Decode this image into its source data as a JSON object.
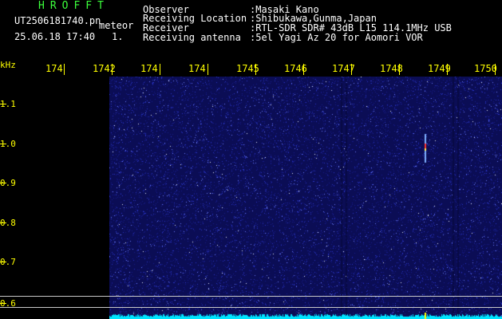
{
  "header": {
    "station_code": "HROFFT",
    "filename": "UT2506181740.pn",
    "mode": "meteor",
    "datetime": "25.06.18 17:40",
    "sequence": "1.",
    "fields": [
      {
        "label": "Observer",
        "value": ":Masaki Kano"
      },
      {
        "label": "Receiving Location",
        "value": ":Shibukawa,Gunma,Japan"
      },
      {
        "label": "Receiver",
        "value": ":RTL-SDR SDR# 43dB L15 114.1MHz USB"
      },
      {
        "label": "Receiving antenna",
        "value": ":5el Yagi Az 20 for Aomori VOR"
      }
    ]
  },
  "time_axis": {
    "labels": [
      "174",
      "1742",
      "174",
      "174",
      "1745",
      "1746",
      "1747",
      "1748",
      "1749",
      "1750"
    ]
  },
  "freq_axis": {
    "unit": "kHz",
    "labels": [
      "1.1",
      "1.0",
      "0.9",
      "0.8",
      "0.7",
      "0.6"
    ]
  },
  "colors": {
    "background": "#000000",
    "spectrogram": "#0d0f5e",
    "label_yellow": "#ffff00",
    "header_green": "#3cff3c",
    "power_trace": "#00e5ff"
  }
}
